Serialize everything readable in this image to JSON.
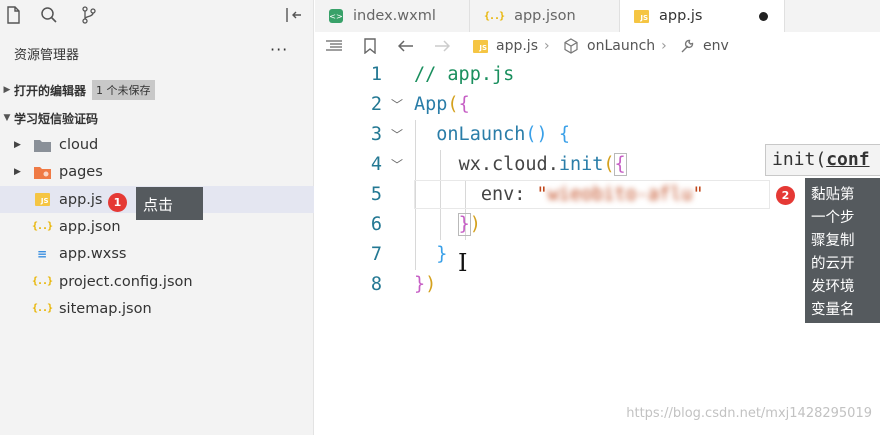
{
  "activity": {
    "icons": [
      "files-icon",
      "search-icon",
      "source-control-icon",
      "toggle-panel-icon"
    ]
  },
  "sidebar": {
    "title": "资源管理器",
    "more": "···",
    "open_editors": {
      "label": "打开的编辑器",
      "badge": "1 个未保存"
    },
    "project": {
      "label": "学习短信验证码"
    },
    "items": [
      {
        "label": "cloud",
        "type": "folder"
      },
      {
        "label": "pages",
        "type": "folder"
      },
      {
        "label": "app.js",
        "type": "js"
      },
      {
        "label": "app.json",
        "type": "json"
      },
      {
        "label": "app.wxss",
        "type": "css"
      },
      {
        "label": "project.config.json",
        "type": "json"
      },
      {
        "label": "sitemap.json",
        "type": "json"
      }
    ]
  },
  "callouts": [
    {
      "number": "1",
      "text": "点击"
    },
    {
      "number": "2",
      "text": [
        "黏贴第",
        "一个步",
        "骤复制",
        "的云开",
        "发环境",
        "变量名"
      ]
    }
  ],
  "tabs": [
    {
      "label": "index.wxml",
      "icon": "wxml-icon"
    },
    {
      "label": "app.json",
      "icon": "json-icon"
    },
    {
      "label": "app.js",
      "icon": "js-icon",
      "active": true,
      "dirty": true
    }
  ],
  "breadcrumb": [
    "app.js",
    "onLaunch",
    "env"
  ],
  "code": {
    "line_numbers": [
      "1",
      "2",
      "3",
      "4",
      "5",
      "6",
      "7",
      "8"
    ],
    "comment": "// app.js",
    "app": "App",
    "onlaunch": "onLaunch",
    "wx": "wx",
    "cloud": "cloud",
    "init": "init",
    "env_key": "env",
    "env_value_blurred": "wieobito-aflu"
  },
  "hover": {
    "text": "init(",
    "bold": "conf"
  },
  "watermark": "https://blog.csdn.net/mxj1428295019",
  "colors": {
    "accent_red": "#e53935",
    "selected_row": "#e4e6f1",
    "js_yellow": "#f5c543"
  }
}
